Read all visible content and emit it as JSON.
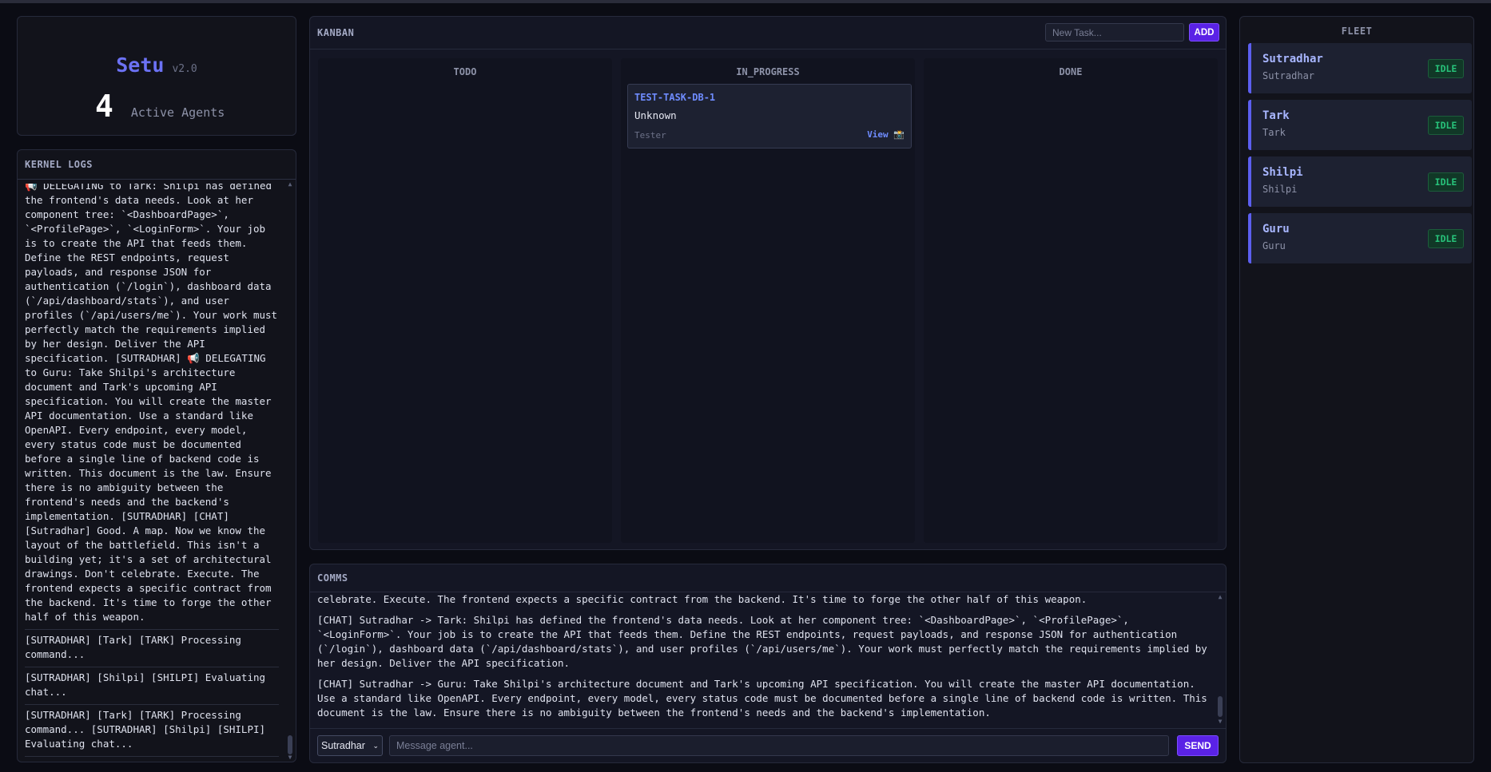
{
  "app": {
    "name": "Setu",
    "version": "v2.0",
    "active_agents_count": "4",
    "active_agents_label": "Active Agents"
  },
  "logs": {
    "title": "KERNEL LOGS",
    "entries": [
      "[SUTRADHAR] [DEBUG] Sutradhar generated final response: Good. A map. Now we know the layout of the battlef... [SUTRADHAR] 📢 DELEGATING to Tark: Shilpi has defined the frontend's data needs. Look at her component tree: `<DashboardPage>`, `<ProfilePage>`, `<LoginForm>`. Your job is to create the API that feeds them. Define the REST endpoints, request payloads, and response JSON for authentication (`/login`), dashboard data (`/api/dashboard/stats`), and user profiles (`/api/users/me`). Your work must perfectly match the requirements implied by her design. Deliver the API specification. [SUTRADHAR] 📢 DELEGATING to Guru: Take Shilpi's architecture document and Tark's upcoming API specification. You will create the master API documentation. Use a standard like OpenAPI. Every endpoint, every model, every status code must be documented before a single line of backend code is written. This document is the law. Ensure there is no ambiguity between the frontend's needs and the backend's implementation. [SUTRADHAR] [CHAT] [Sutradhar] Good. A map. Now we know the layout of the battlefield. This isn't a building yet; it's a set of architectural drawings. Don't celebrate. Execute. The frontend expects a specific contract from the backend. It's time to forge the other half of this weapon.",
      "[SUTRADHAR] [Tark] [TARK] Processing command...",
      "[SUTRADHAR] [Shilpi] [SHILPI] Evaluating chat...",
      "[SUTRADHAR] [Tark] [TARK] Processing command... [SUTRADHAR] [Shilpi] [SHILPI] Evaluating chat..."
    ]
  },
  "kanban": {
    "title": "KANBAN",
    "new_task_placeholder": "New Task...",
    "add_label": "ADD",
    "columns": {
      "todo": "TODO",
      "in_progress": "IN_PROGRESS",
      "done": "DONE"
    },
    "task": {
      "id": "TEST-TASK-DB-1",
      "title": "Unknown",
      "assignee": "Tester",
      "view_label": "View 📸"
    }
  },
  "comms": {
    "title": "COMMS",
    "messages": [
      "celebrate. Execute. The frontend expects a specific contract from the backend. It's time to forge the other half of this weapon.",
      "[CHAT] Sutradhar -> Tark: Shilpi has defined the frontend's data needs. Look at her component tree: `<DashboardPage>`, `<ProfilePage>`, `<LoginForm>`. Your job is to create the API that feeds them. Define the REST endpoints, request payloads, and response JSON for authentication (`/login`), dashboard data (`/api/dashboard/stats`), and user profiles (`/api/users/me`). Your work must perfectly match the requirements implied by her design. Deliver the API specification.",
      "[CHAT] Sutradhar -> Guru: Take Shilpi's architecture document and Tark's upcoming API specification. You will create the master API documentation. Use a standard like OpenAPI. Every endpoint, every model, every status code must be documented before a single line of backend code is written. This document is the law. Ensure there is no ambiguity between the frontend's needs and the backend's implementation."
    ],
    "selected_agent": "Sutradhar",
    "message_placeholder": "Message agent...",
    "send_label": "SEND"
  },
  "fleet": {
    "title": "FLEET",
    "agents": [
      {
        "name": "Sutradhar",
        "role": "Sutradhar",
        "status": "IDLE"
      },
      {
        "name": "Tark",
        "role": "Tark",
        "status": "IDLE"
      },
      {
        "name": "Shilpi",
        "role": "Shilpi",
        "status": "IDLE"
      },
      {
        "name": "Guru",
        "role": "Guru",
        "status": "IDLE"
      }
    ]
  },
  "colors": {
    "accent": "#5a22e6",
    "brand": "#6c72f5",
    "status_idle": "#27c27a",
    "background": "#0b0c14"
  }
}
